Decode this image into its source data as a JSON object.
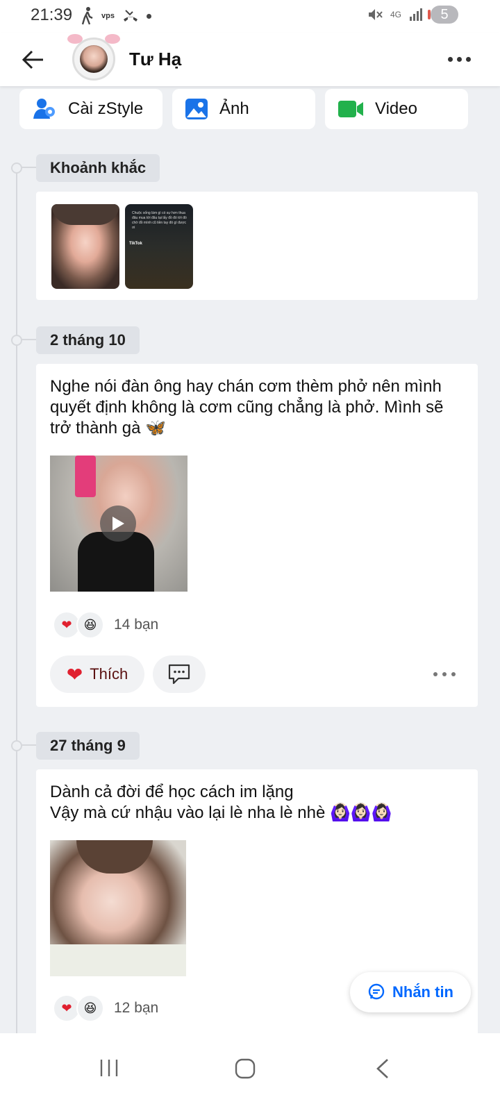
{
  "status": {
    "time": "21:39",
    "carrier": "vps",
    "network": "4G",
    "battery": "5"
  },
  "header": {
    "title": "Tư Hạ"
  },
  "actions": [
    {
      "label": "Cài zStyle",
      "icon": "person-style-icon"
    },
    {
      "label": "Ảnh",
      "icon": "image-icon"
    },
    {
      "label": "Video",
      "icon": "video-camera-icon"
    }
  ],
  "sections": {
    "moments_label": "Khoảnh khắc",
    "moment_thumb_text": "Chuộc sống làm gì có sự hơn thua đâu mua tới đâu tại lấy đồ đó tới đó chờ đồ mình cũ tiền tay đó gì được ơi",
    "moment_thumb_brand": "TikTok"
  },
  "posts": [
    {
      "date": "2 tháng 10",
      "text_lines": [
        "Nghe nói đàn ông hay chán cơm thèm phở nên mình",
        "quyết định không là cơm cũng chẳng là phở. Mình sẽ",
        "trở thành gà 🦋"
      ],
      "reactions": "14 bạn",
      "like_label": "Thích"
    },
    {
      "date": "27 tháng 9",
      "text_lines": [
        "Dành cả đời để học cách im lặng",
        "Vậy mà cứ nhậu vào lại lè nha lè nhè 🙆🏻‍♀️🙆🏻‍♀️🙆🏻‍♀️"
      ],
      "reactions": "12 bạn"
    }
  ],
  "fab": {
    "label": "Nhắn tin"
  },
  "colors": {
    "accent": "#0068ff",
    "heart": "#e0202f",
    "background": "#eef0f3"
  }
}
